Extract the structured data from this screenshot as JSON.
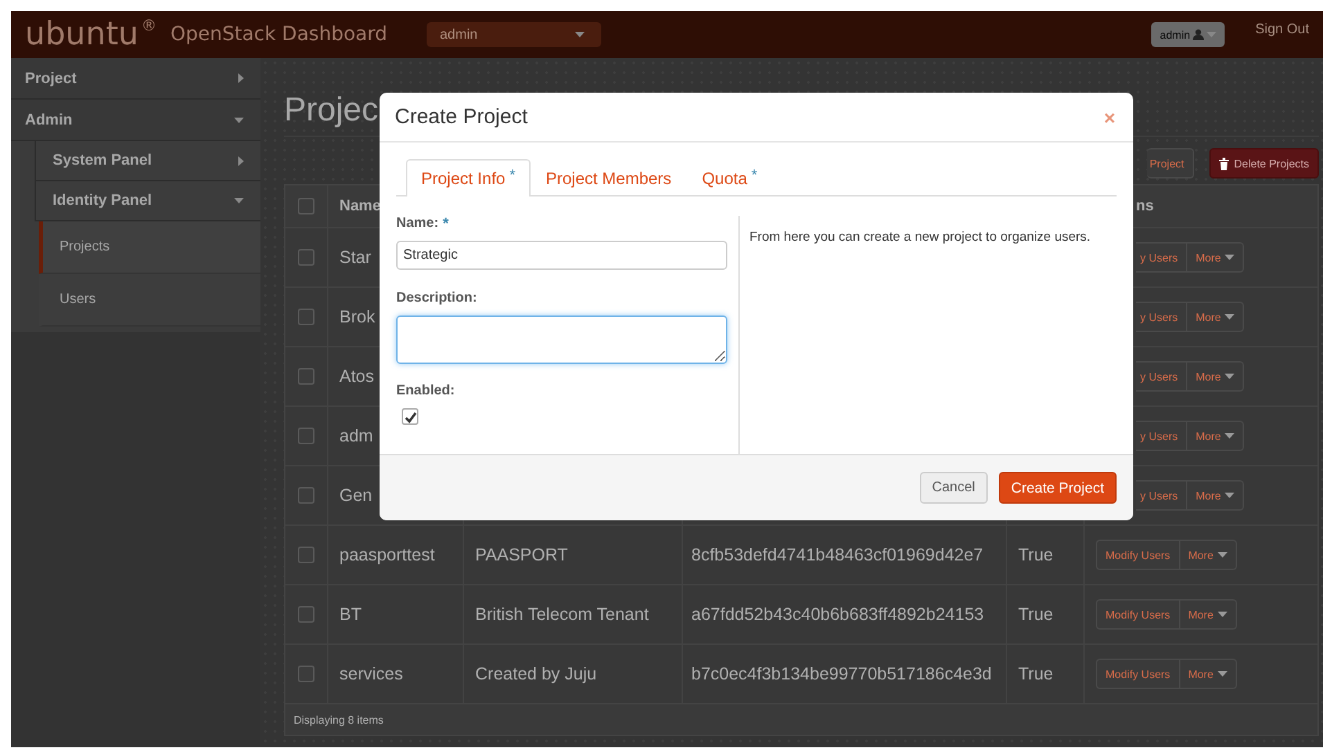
{
  "header": {
    "logo": "ubuntu",
    "logo_mark": "®",
    "product": "OpenStack Dashboard",
    "project_select": "admin",
    "user_menu": "admin",
    "sign_out": "Sign Out"
  },
  "sidebar": {
    "items": [
      {
        "label": "Project",
        "expanded": false
      },
      {
        "label": "Admin",
        "expanded": true,
        "children": [
          {
            "label": "System Panel",
            "expanded": false
          },
          {
            "label": "Identity Panel",
            "expanded": true,
            "children": [
              {
                "label": "Projects",
                "selected": true
              },
              {
                "label": "Users",
                "selected": false
              }
            ]
          }
        ]
      }
    ]
  },
  "page": {
    "title": "Projec",
    "actions": [
      {
        "label": "Project",
        "kind": "cut"
      },
      {
        "label": "Delete Projects",
        "kind": "danger"
      }
    ]
  },
  "table": {
    "header_name": "Name",
    "header_actions": "ns",
    "header_checked": false,
    "rows": [
      {
        "checked": false,
        "name": "Star",
        "modify": "y Users",
        "more": "More",
        "cut": true
      },
      {
        "checked": false,
        "name": "Brok",
        "modify": "y Users",
        "more": "More",
        "cut": true
      },
      {
        "checked": false,
        "name": "Atos",
        "modify": "y Users",
        "more": "More",
        "cut": true
      },
      {
        "checked": false,
        "name": "adm",
        "modify": "y Users",
        "more": "More",
        "cut": true
      },
      {
        "checked": false,
        "name": "Gen",
        "modify": "y Users",
        "more": "More",
        "cut": true
      },
      {
        "checked": false,
        "name": "paasporttest",
        "description": "PAASPORT",
        "id": "8cfb53defd4741b48463cf01969d42e7",
        "enabled": "True",
        "modify": "Modify Users",
        "more": "More",
        "cut": false
      },
      {
        "checked": false,
        "name": "BT",
        "description": "British Telecom Tenant",
        "id": "a67fdd52b43c40b6b683ff4892b24153",
        "enabled": "True",
        "modify": "Modify Users",
        "more": "More",
        "cut": false
      },
      {
        "checked": false,
        "name": "services",
        "description": "Created by Juju",
        "id": "b7c0ec4f3b134be99770b517186c4e3d",
        "enabled": "True",
        "modify": "Modify Users",
        "more": "More",
        "cut": false
      }
    ],
    "footer": "Displaying 8 items"
  },
  "modal": {
    "title": "Create Project",
    "close": "×",
    "tabs": [
      {
        "label": "Project Info",
        "mark": "*",
        "selected": true
      },
      {
        "label": "Project Members",
        "selected": false
      },
      {
        "label": "Quota",
        "mark": "*",
        "selected": false
      }
    ],
    "fields": [
      {
        "kind": "text",
        "label": "Name:",
        "mark": "*",
        "value": "Strategic",
        "focused": false
      },
      {
        "kind": "textarea",
        "label": "Description:",
        "focused": true
      },
      {
        "kind": "checkbox",
        "label": "Enabled:",
        "checked": true
      }
    ],
    "help": "From here you can create a new project to organize users.",
    "buttons": [
      {
        "label": "Cancel",
        "kind": "default"
      },
      {
        "label": "Create Project",
        "kind": "primary"
      }
    ]
  }
}
